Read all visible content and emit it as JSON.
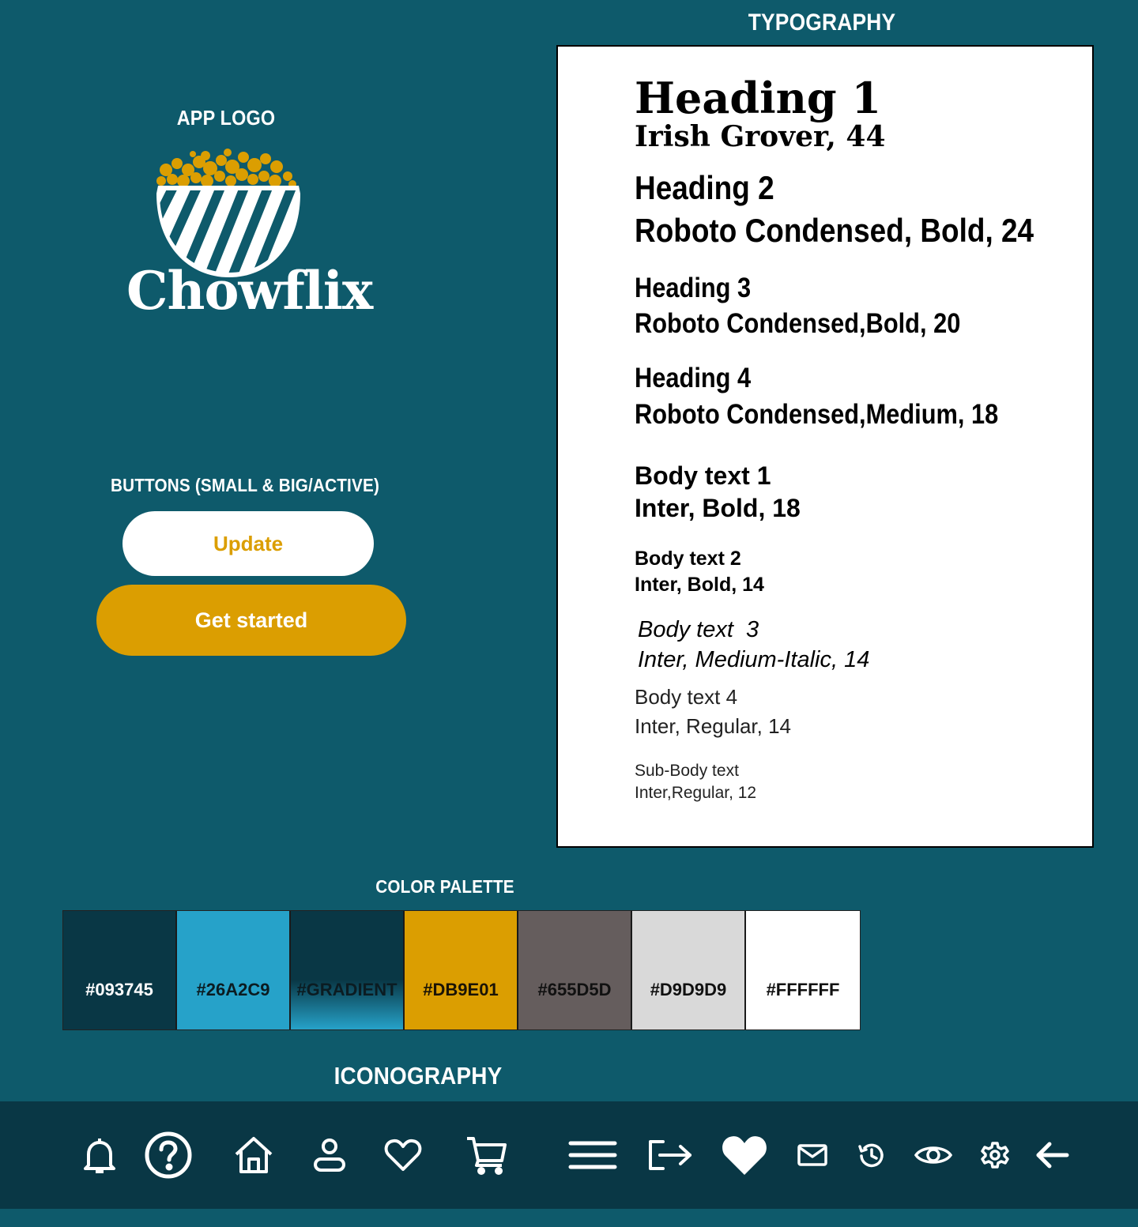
{
  "sections": {
    "typography": "TYPOGRAPHY",
    "app_logo": "APP LOGO",
    "buttons": "BUTTONS (SMALL & BIG/ACTIVE)",
    "color_palette": "COLOR PALETTE",
    "iconography": "ICONOGRAPHY"
  },
  "logo": {
    "wordmark": "Chowflix",
    "colors": {
      "bowl": "#ffffff",
      "popcorn": "#db9e01"
    }
  },
  "buttons": {
    "small_label": "Update",
    "big_label": "Get started"
  },
  "typography": [
    {
      "name": "Heading 1",
      "spec": "Irish Grover, 44"
    },
    {
      "name": "Heading 2",
      "spec": "Roboto Condensed, Bold, 24"
    },
    {
      "name": "Heading 3",
      "spec": "Roboto Condensed,Bold, 20"
    },
    {
      "name": "Heading 4",
      "spec": "Roboto Condensed,Medium, 18"
    },
    {
      "name": "Body text 1",
      "spec": "Inter, Bold, 18"
    },
    {
      "name": "Body text 2",
      "spec": "Inter, Bold, 14"
    },
    {
      "name": "Body text  3",
      "spec": "Inter, Medium-Italic, 14"
    },
    {
      "name": "Body text 4",
      "spec": "Inter, Regular, 14"
    },
    {
      "name": "Sub-Body text",
      "spec": "Inter,Regular, 12"
    }
  ],
  "palette": [
    {
      "label": "#093745",
      "color": "#093745"
    },
    {
      "label": "#26A2C9",
      "color": "#26A2C9"
    },
    {
      "label": "#GRADIENT",
      "color": "gradient"
    },
    {
      "label": "#DB9E01",
      "color": "#DB9E01"
    },
    {
      "label": "#655D5D",
      "color": "#655D5D"
    },
    {
      "label": "#D9D9D9",
      "color": "#D9D9D9"
    },
    {
      "label": "#FFFFFF",
      "color": "#FFFFFF"
    }
  ],
  "icons": [
    "bell-icon",
    "help-icon",
    "home-icon",
    "user-icon",
    "heart-outline-icon",
    "cart-icon",
    "menu-icon",
    "logout-icon",
    "heart-filled-icon",
    "mail-icon",
    "history-icon",
    "eye-icon",
    "gear-icon",
    "arrow-left-icon"
  ]
}
